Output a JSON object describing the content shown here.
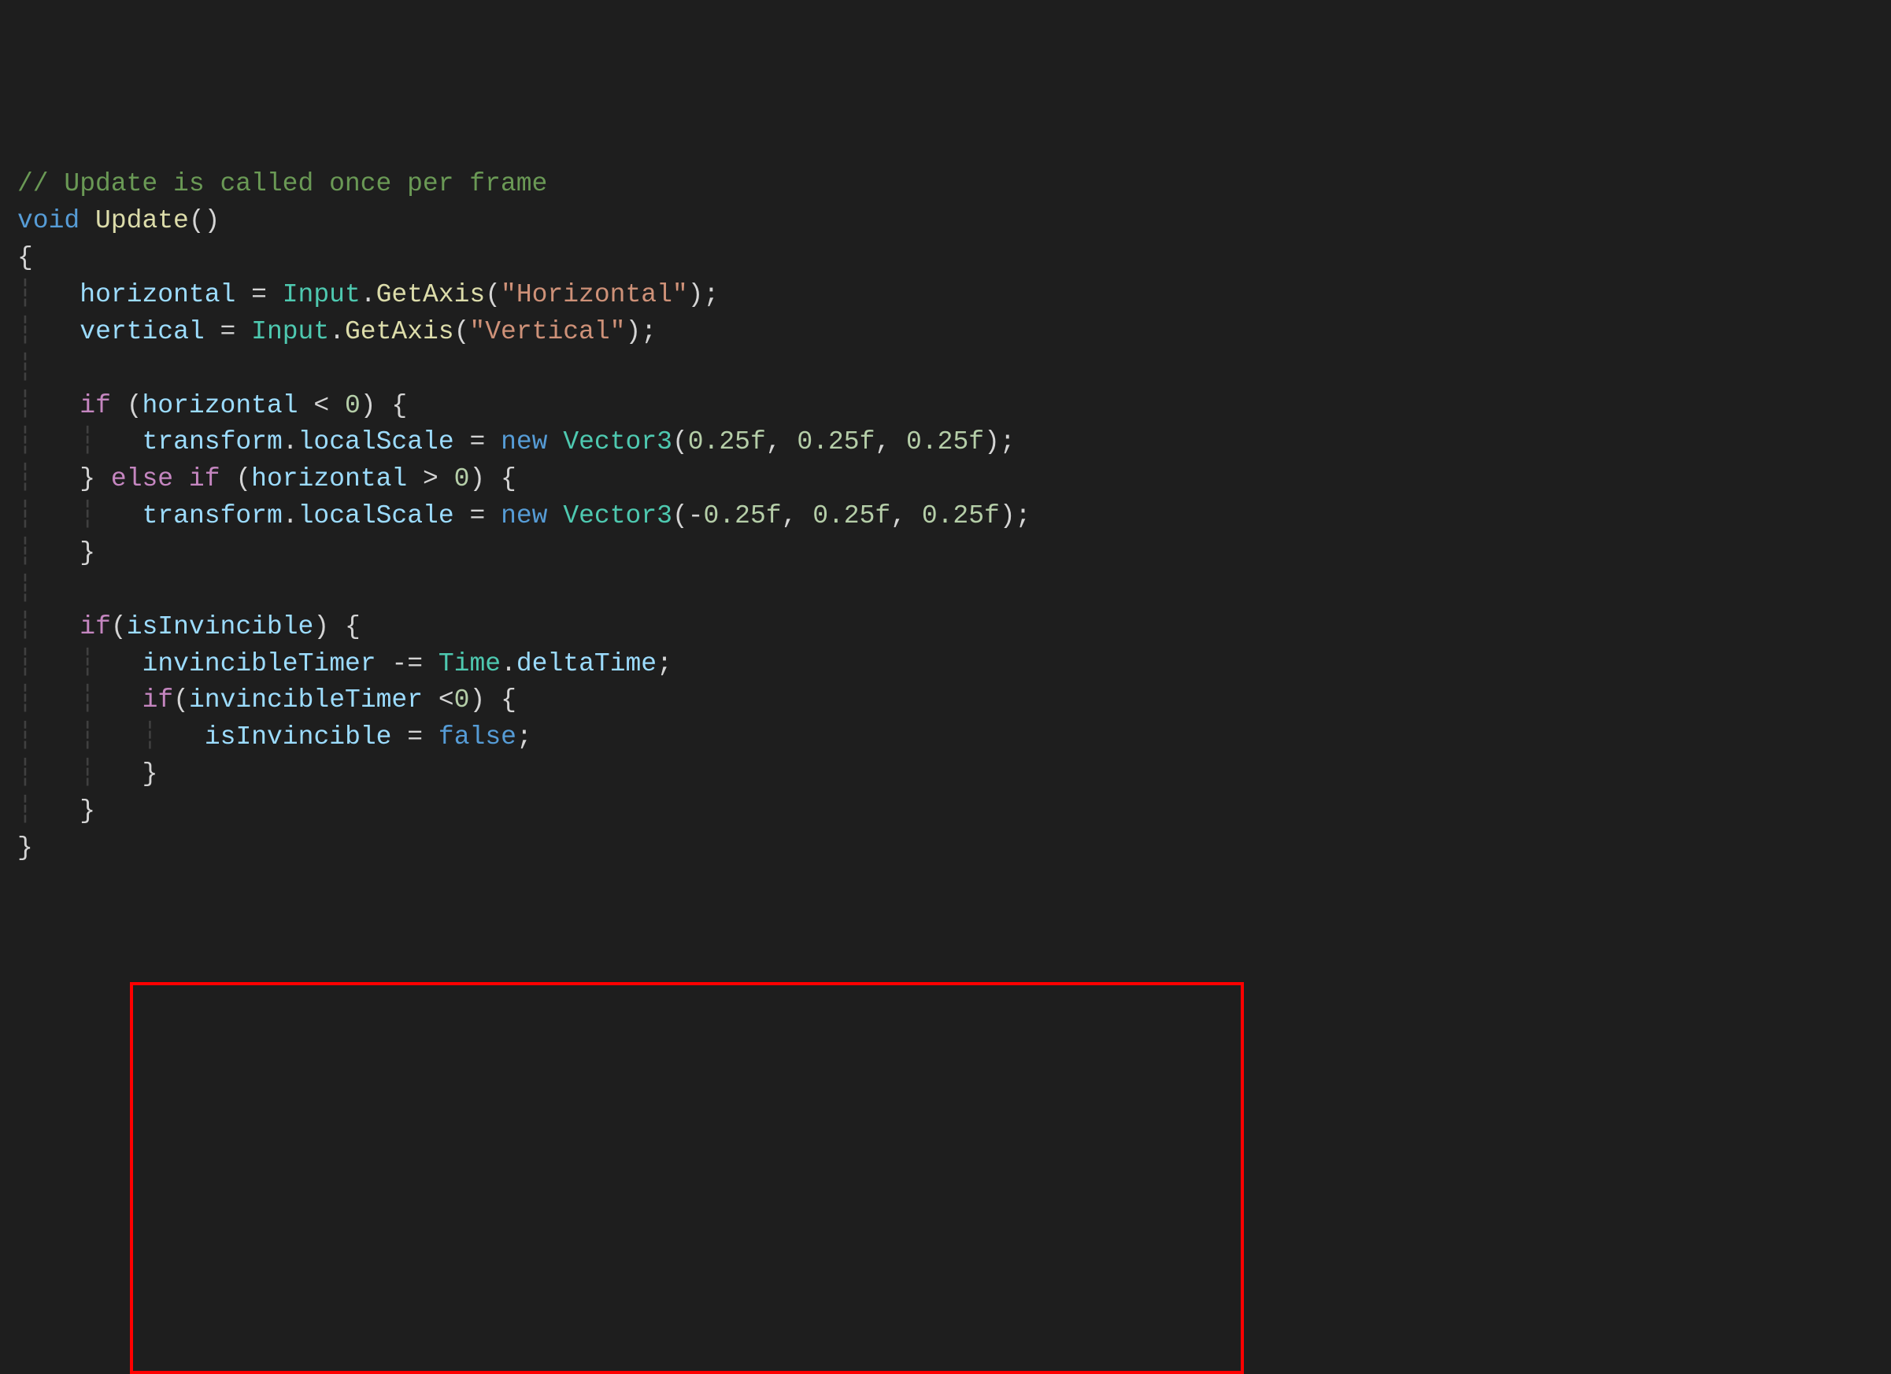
{
  "code": {
    "line1_comment": "// Update is called once per frame",
    "line2_void": "void",
    "line2_method": "Update",
    "line2_parens": "()",
    "line3_brace": "{",
    "line4_var1": "horizontal",
    "line4_eq": " = ",
    "line4_class": "Input",
    "line4_dot": ".",
    "line4_method": "GetAxis",
    "line4_lparen": "(",
    "line4_string": "\"Horizontal\"",
    "line4_end": ");",
    "line5_var1": "vertical",
    "line5_eq": " = ",
    "line5_class": "Input",
    "line5_dot": ".",
    "line5_method": "GetAxis",
    "line5_lparen": "(",
    "line5_string": "\"Vertical\"",
    "line5_end": ");",
    "line7_if": "if",
    "line7_lparen": " (",
    "line7_var": "horizontal",
    "line7_op": " < ",
    "line7_num": "0",
    "line7_end": ") {",
    "line8_obj": "transform",
    "line8_dot": ".",
    "line8_prop": "localScale",
    "line8_eq": " = ",
    "line8_new": "new",
    "line8_sp": " ",
    "line8_type": "Vector3",
    "line8_lparen": "(",
    "line8_n1": "0.25f",
    "line8_c1": ", ",
    "line8_n2": "0.25f",
    "line8_c2": ", ",
    "line8_n3": "0.25f",
    "line8_end": ");",
    "line9_brace": "}",
    "line9_else": " else if",
    "line9_lparen": " (",
    "line9_var": "horizontal",
    "line9_op": " > ",
    "line9_num": "0",
    "line9_end": ") {",
    "line10_obj": "transform",
    "line10_dot": ".",
    "line10_prop": "localScale",
    "line10_eq": " = ",
    "line10_new": "new",
    "line10_sp": " ",
    "line10_type": "Vector3",
    "line10_lparen": "(-",
    "line10_n1": "0.25f",
    "line10_c1": ", ",
    "line10_n2": "0.25f",
    "line10_c2": ", ",
    "line10_n3": "0.25f",
    "line10_end": ");",
    "line11_brace": "}",
    "line13_if": "if",
    "line13_lparen": "(",
    "line13_var": "isInvincible",
    "line13_end": ") {",
    "line14_var": "invincibleTimer",
    "line14_op": " -= ",
    "line14_class": "Time",
    "line14_dot": ".",
    "line14_prop": "deltaTime",
    "line14_end": ";",
    "line15_if": "if",
    "line15_lparen": "(",
    "line15_var": "invincibleTimer",
    "line15_op": " <",
    "line15_num": "0",
    "line15_end": ") {",
    "line16_var": "isInvincible",
    "line16_eq": " = ",
    "line16_val": "false",
    "line16_end": ";",
    "line17_brace": "}",
    "line18_brace": "}",
    "line19_brace": "}"
  }
}
